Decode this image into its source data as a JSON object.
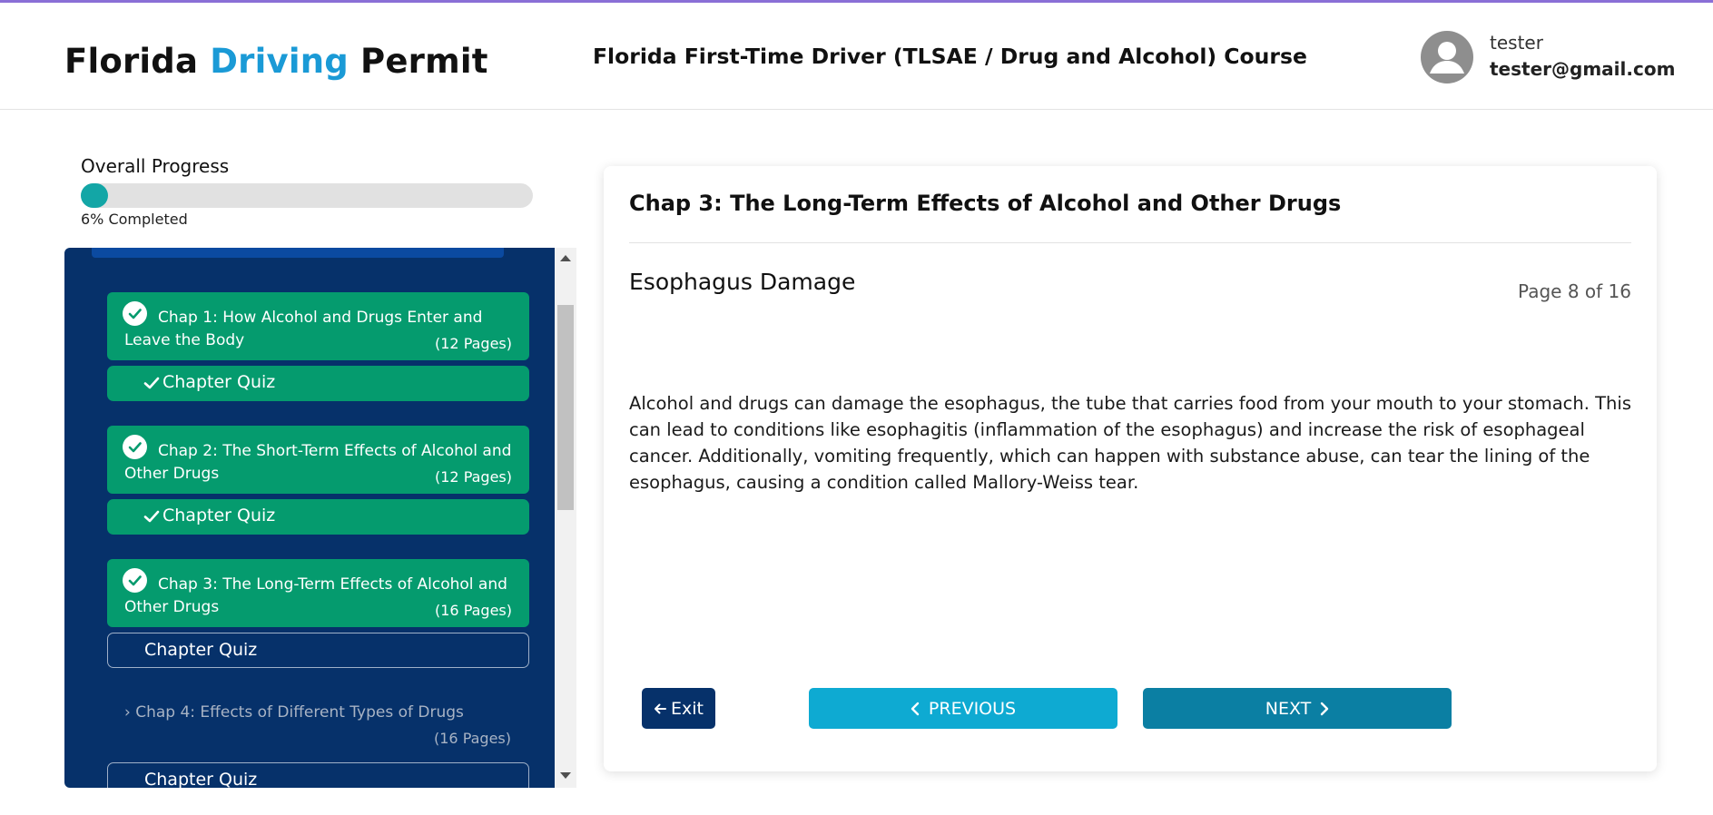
{
  "header": {
    "logo": {
      "part1": "Florida",
      "part2": "Driving",
      "part3": "Permit"
    },
    "course_title": "Florida First-Time Driver (TLSAE / Drug and Alcohol) Course",
    "user": {
      "name": "tester",
      "email": "tester@gmail.com",
      "avatar_icon": "user-avatar-icon"
    }
  },
  "progress": {
    "label": "Overall Progress",
    "percent": 6,
    "text": "6% Completed",
    "fill_color": "#13a6a6"
  },
  "sidebar": {
    "chapters": [
      {
        "title": "Chap 1: How Alcohol and Drugs Enter and Leave the Body",
        "pages": "(12 Pages)",
        "completed": true,
        "quiz_label": "Chapter Quiz",
        "quiz_completed": true
      },
      {
        "title": "Chap 2: The Short-Term Effects of Alcohol and Other Drugs",
        "pages": "(12 Pages)",
        "completed": true,
        "quiz_label": "Chapter Quiz",
        "quiz_completed": true
      },
      {
        "title": "Chap 3: The Long-Term Effects of Alcohol and Other Drugs",
        "pages": "(16 Pages)",
        "completed": true,
        "quiz_label": "Chapter Quiz",
        "quiz_completed": false
      },
      {
        "title": "Chap 4: Effects of Different Types of Drugs",
        "pages": "(16 Pages)",
        "completed": false,
        "quiz_label": "Chapter Quiz",
        "quiz_completed": false
      }
    ],
    "colors": {
      "background": "#06316a",
      "completed": "#059b6e"
    }
  },
  "content": {
    "chapter_title": "Chap 3: The Long-Term Effects of Alcohol and Other Drugs",
    "section_title": "Esophagus Damage",
    "page_indicator": "Page 8 of 16",
    "body": "Alcohol and drugs can damage the esophagus, the tube that carries food from your mouth to your stomach. This can lead to conditions like esophagitis (inflammation of the esophagus) and increase the risk of esophageal cancer. Additionally, vomiting frequently, which can happen with substance abuse, can tear the lining of the esophagus, causing a condition called Mallory-Weiss tear."
  },
  "buttons": {
    "exit": "Exit",
    "previous": "PREVIOUS",
    "next": "NEXT"
  }
}
